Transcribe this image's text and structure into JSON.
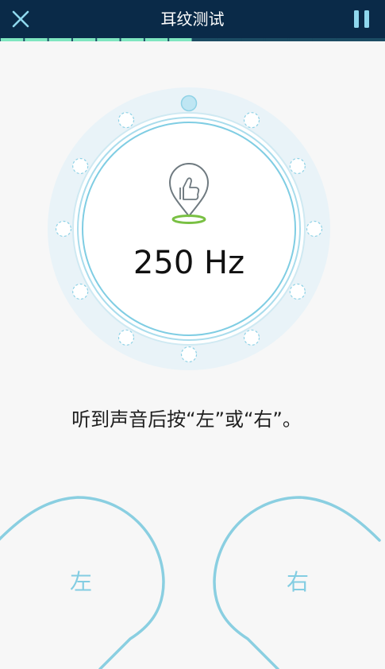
{
  "header": {
    "title": "耳纹测试",
    "close_icon": "close-icon",
    "pause_icon": "pause-icon"
  },
  "progress": {
    "completed_segments": 8,
    "total_segments": 16,
    "done_color": "#7fe6c0",
    "pending_color": "#1b4b63"
  },
  "dial": {
    "frequency": "250 Hz",
    "icon": "thumbs-up-pin-icon",
    "active_dot_index": 0,
    "dot_count": 12,
    "accent_color": "#8fd2e6"
  },
  "instruction": "听到声音后按“左”或“右”。",
  "buttons": {
    "left_label": "左",
    "right_label": "右"
  }
}
